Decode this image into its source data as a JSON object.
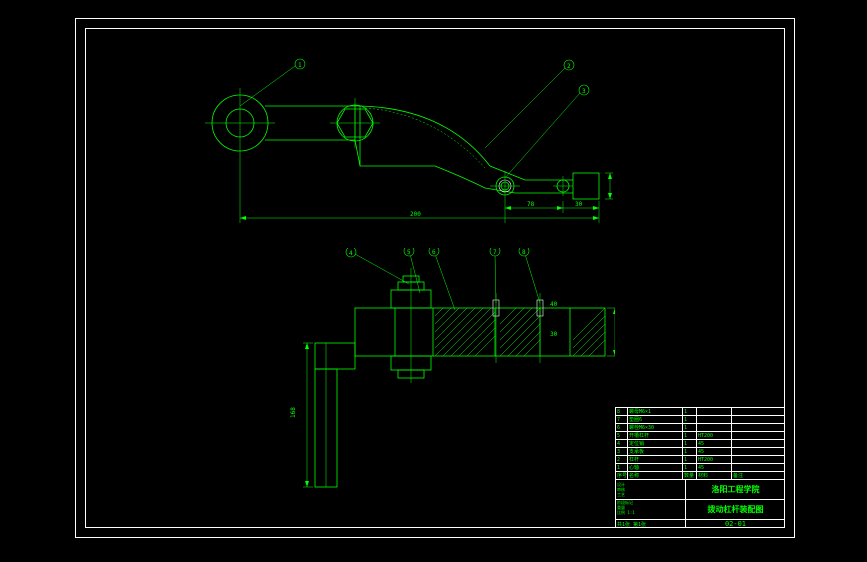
{
  "balloons_top": [
    "1",
    "2",
    "3"
  ],
  "balloons_bottom": [
    "4",
    "5",
    "6",
    "7",
    "8"
  ],
  "dims": {
    "top_main": "200",
    "top_right_h": "78",
    "top_right_gap": "30",
    "vert_left": "168",
    "side_v1": "30",
    "side_v2": "40"
  },
  "titleblock": {
    "parts": [
      {
        "no": "8",
        "name": "螺母M6×1",
        "qty": "1",
        "mat": "",
        "note": ""
      },
      {
        "no": "7",
        "name": "垫圈6",
        "qty": "1",
        "mat": "",
        "note": ""
      },
      {
        "no": "6",
        "name": "螺栓M6×30",
        "qty": "1",
        "mat": "",
        "note": ""
      },
      {
        "no": "5",
        "name": "开槽杠杆",
        "qty": "1",
        "mat": "HT200",
        "note": ""
      },
      {
        "no": "4",
        "name": "定位销",
        "qty": "1",
        "mat": "45",
        "note": ""
      },
      {
        "no": "3",
        "name": "支承板",
        "qty": "1",
        "mat": "45",
        "note": ""
      },
      {
        "no": "2",
        "name": "杠杆",
        "qty": "1",
        "mat": "HT200",
        "note": ""
      },
      {
        "no": "1",
        "name": "心轴",
        "qty": "1",
        "mat": "45",
        "note": ""
      }
    ],
    "headers": {
      "no": "序号",
      "name": "名称",
      "qty": "数量",
      "mat": "材料",
      "note": "备注"
    },
    "org": "洛阳工程学院",
    "title": "拨动杠杆装配图",
    "dwgno": "02-01",
    "scale_lbl": "比例",
    "scale": "1:1",
    "sheet": "共1张 第1张",
    "design": "设计",
    "check": "审核",
    "approve": "工艺",
    "date": "日期",
    "weight": "重量",
    "stage": "阶段标记"
  }
}
